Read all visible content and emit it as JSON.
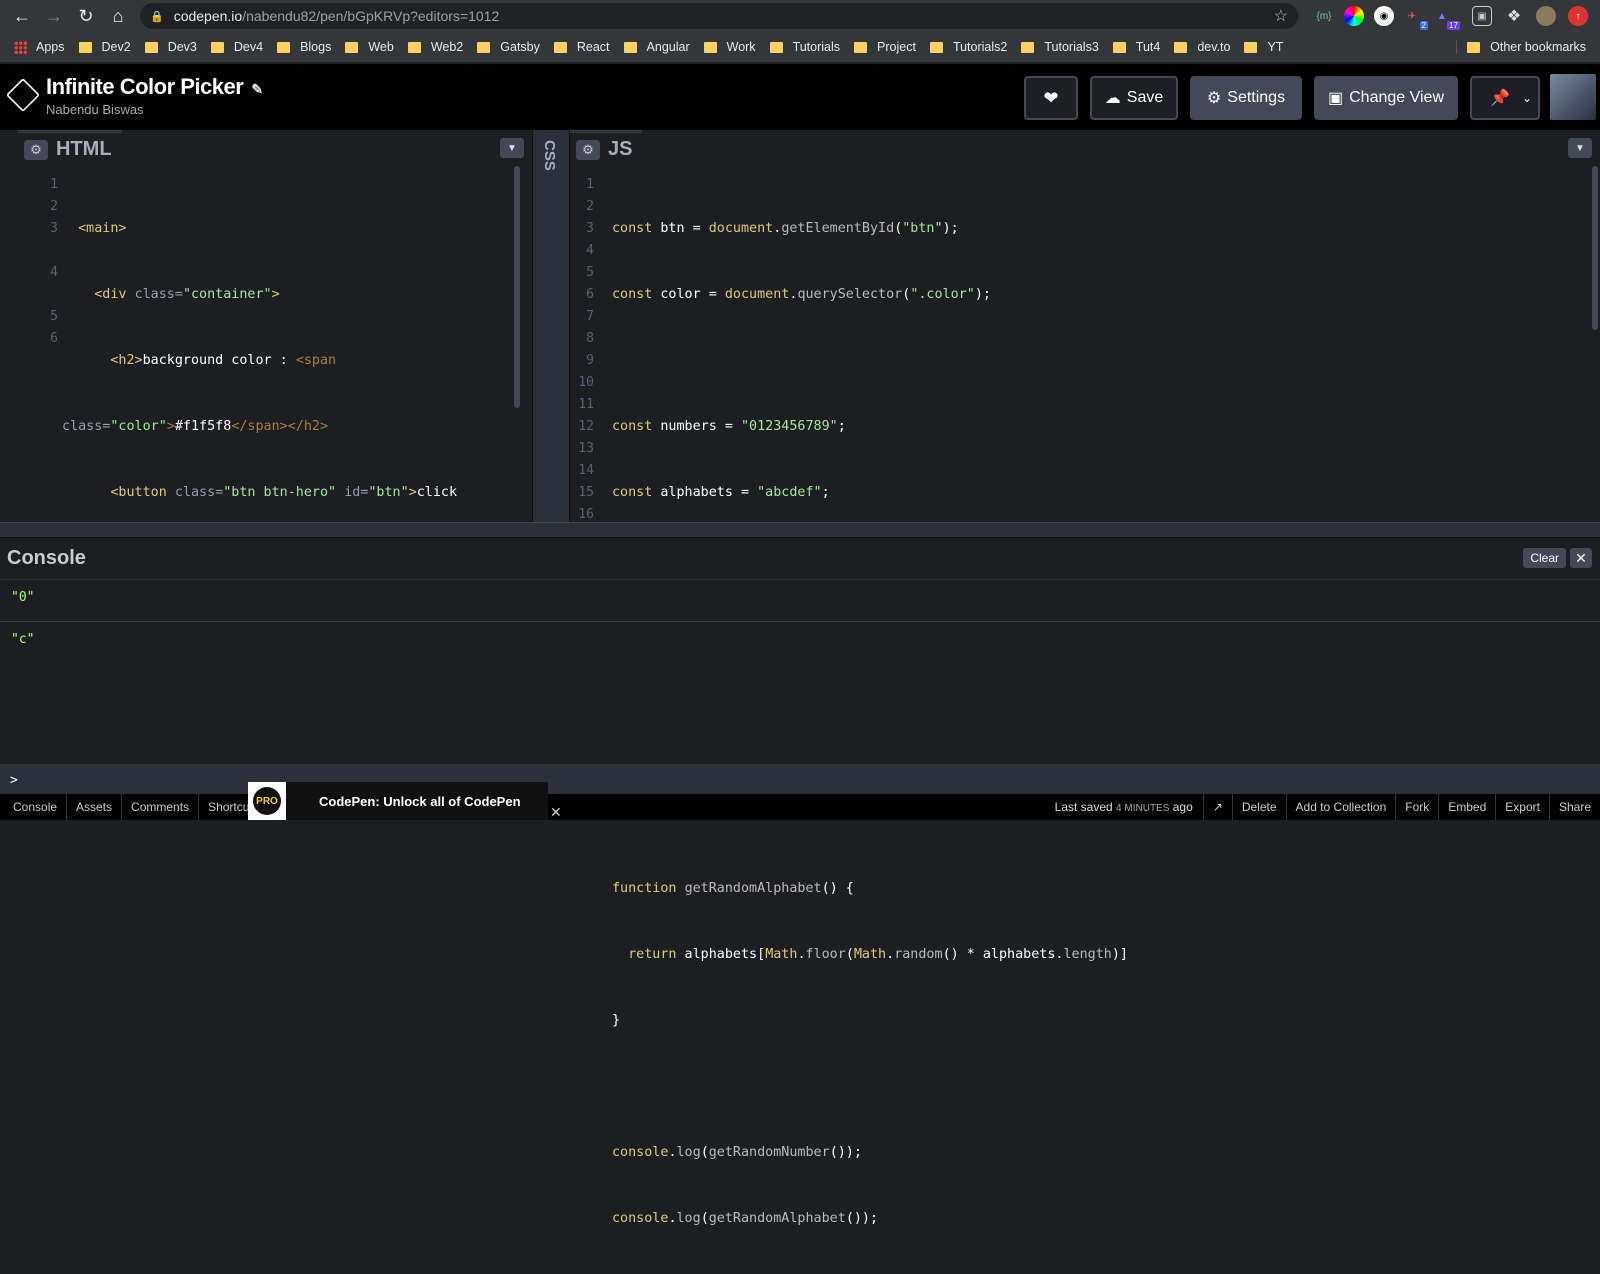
{
  "browser": {
    "url_host": "codepen.io",
    "url_path": "/nabendu82/pen/bGpKRVp?editors=1012",
    "bookmarks": [
      "Apps",
      "Dev2",
      "Dev3",
      "Dev4",
      "Blogs",
      "Web",
      "Web2",
      "Gatsby",
      "React",
      "Angular",
      "Work",
      "Tutorials",
      "Project",
      "Tutorials2",
      "Tutorials3",
      "Tut4",
      "dev.to",
      "YT"
    ],
    "other_bookmarks": "Other bookmarks",
    "extension_badges": [
      "2",
      "17"
    ]
  },
  "header": {
    "title": "Infinite Color Picker",
    "author": "Nabendu Biswas",
    "save_label": "Save",
    "settings_label": "Settings",
    "change_view_label": "Change View"
  },
  "html_editor": {
    "label": "HTML",
    "line_numbers": [
      "1",
      "2",
      "3",
      "",
      "4",
      "",
      "5",
      "6"
    ]
  },
  "css_editor": {
    "label": "CSS"
  },
  "js_editor": {
    "label": "JS",
    "line_numbers": [
      "1",
      "2",
      "3",
      "4",
      "5",
      "6",
      "7",
      "8",
      "9",
      "10",
      "11",
      "12",
      "13",
      "14",
      "15",
      "16"
    ]
  },
  "console": {
    "title": "Console",
    "clear_label": "Clear",
    "logs": [
      "\"0\"",
      "\"c\""
    ],
    "prompt": ">"
  },
  "footer": {
    "tabs": [
      "Console",
      "Assets",
      "Comments",
      "Shortcuts"
    ],
    "promo_badge": "PRO",
    "promo_text": "CodePen: Unlock all of CodePen",
    "last_saved_prefix": "Last saved",
    "last_saved_time": "4 MINUTES",
    "last_saved_suffix": "ago",
    "actions": [
      "Delete",
      "Add to Collection",
      "Fork",
      "Embed",
      "Export",
      "Share"
    ]
  }
}
